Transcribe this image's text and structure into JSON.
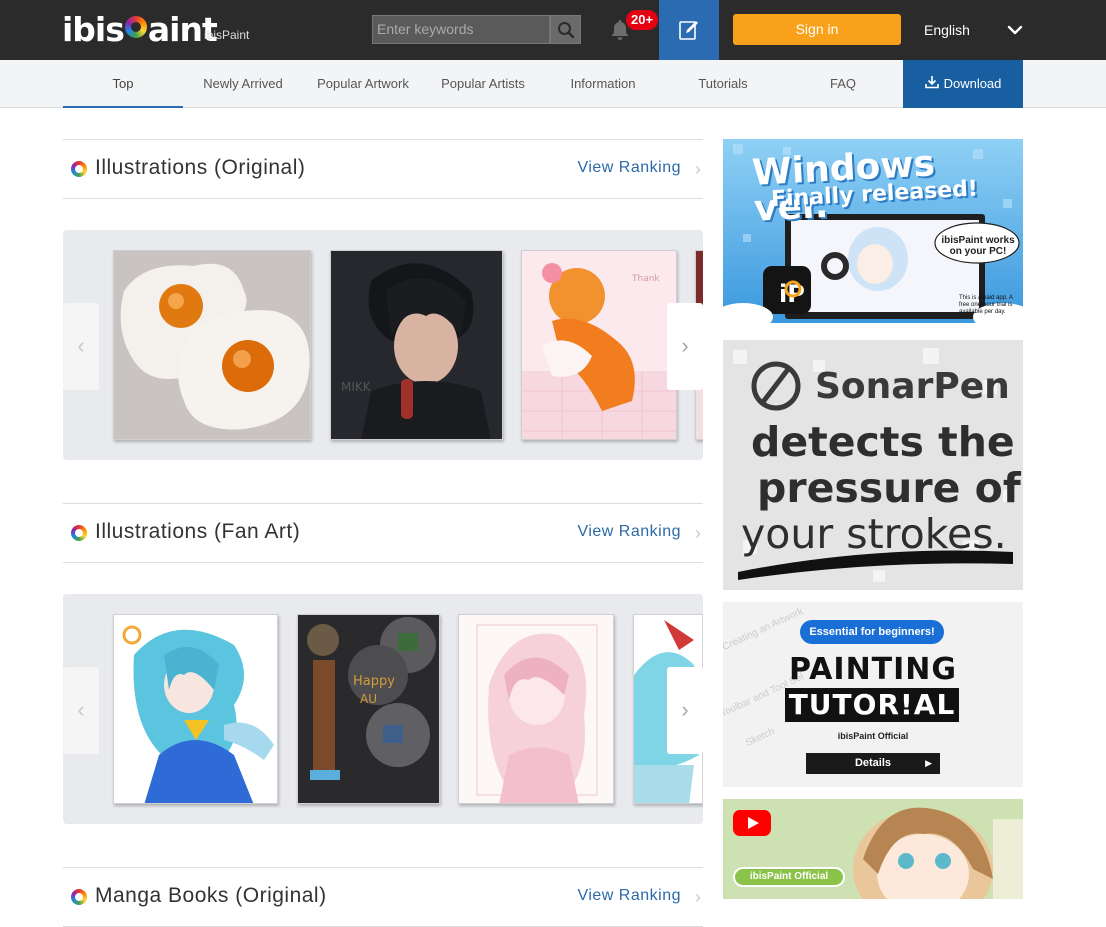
{
  "header": {
    "logo_text_left": "ibis",
    "logo_text_right": "aint",
    "logo_sub": "ibisPaint",
    "search_placeholder": "Enter keywords",
    "notification_count": "20+",
    "signin_label": "Sign in",
    "language": "English"
  },
  "nav": {
    "items": [
      "Top",
      "Newly Arrived",
      "Popular Artwork",
      "Popular Artists",
      "Information",
      "Tutorials",
      "FAQ"
    ],
    "active": "Top",
    "download_label": "Download"
  },
  "sections": [
    {
      "title": "Illustrations (Original)",
      "link": "View Ranking"
    },
    {
      "title": "Illustrations (Fan Art)",
      "link": "View Ranking"
    },
    {
      "title": "Manga Books (Original)",
      "link": "View Ranking"
    }
  ],
  "carousel_arrows": {
    "prev": "‹",
    "next": "›"
  },
  "banners": {
    "windows": {
      "line1": "Windows ver.",
      "line2": "Finally released!",
      "bubble": "ibisPaint works on your PC!",
      "note": "This is a paid app. A free one-hour trial is available per day."
    },
    "sonarpen": {
      "brand": "SonarPen",
      "line1": "detects the",
      "line2": "pressure of",
      "line3": "your strokes."
    },
    "tutorial": {
      "pill": "Essential for beginners!",
      "line1": "PAINTING",
      "line2": "TUTOR!AL",
      "byline": "ibisPaint Official",
      "details": "Details",
      "bg_words": [
        "Creating an Artwork",
        "Toolbar and Tool Sel",
        "Sketch"
      ]
    },
    "youtube": {
      "label": "ibisPaint Official"
    }
  },
  "colors": {
    "header_bg": "#2b2b2b",
    "accent_blue": "#2a6bb2",
    "download_blue": "#175fa0",
    "signin_orange": "#f9a11b",
    "badge_red": "#e60012"
  }
}
